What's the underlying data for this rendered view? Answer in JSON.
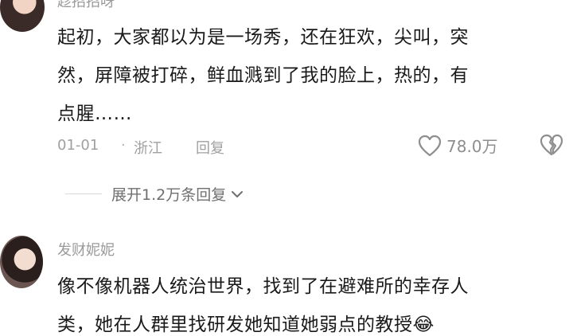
{
  "comments": [
    {
      "username": "趁招招呀",
      "lines": [
        "起初，大家都以为是一场秀，还在狂欢，尖叫，突",
        "然，屏障被打碎，鲜血溅到了我的脸上，热的，有",
        "点腥……"
      ],
      "date": "01-01",
      "separator": "·",
      "location": "浙江",
      "reply_label": "回复",
      "likes": "78.0万",
      "expand_label": "展开1.2万条回复"
    },
    {
      "username": "发财妮妮",
      "lines": [
        "像不像机器人统治世界，找到了在避难所的幸存人",
        "类，她在人群里找研发她知道她弱点的教授😂"
      ]
    }
  ],
  "colors": {
    "text": "#1a1a1a",
    "muted": "#a0a0a0",
    "icon": "#8e8e8e"
  },
  "icons": {
    "like": "heart-outline",
    "dislike": "broken-heart-outline",
    "expand": "chevron-down"
  }
}
